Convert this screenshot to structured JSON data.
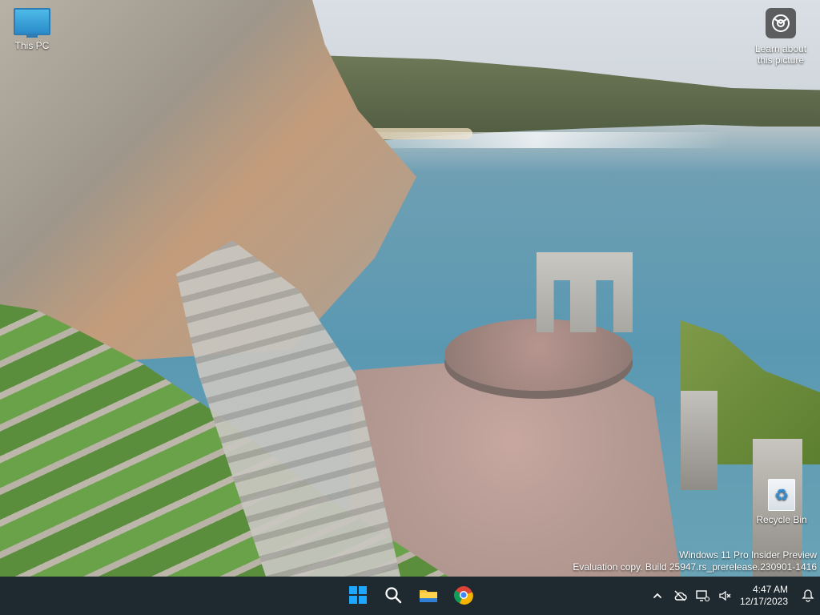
{
  "desktop": {
    "icons": [
      {
        "label": "This PC"
      },
      {
        "label": "Recycle Bin"
      }
    ],
    "spotlight": {
      "label_line1": "Learn about",
      "label_line2": "this picture"
    },
    "watermark": {
      "line1": "Windows 11 Pro Insider Preview",
      "line2": "Evaluation copy. Build 25947.rs_prerelease.230901-1416"
    }
  },
  "taskbar": {
    "apps": [
      {
        "name": "start"
      },
      {
        "name": "search"
      },
      {
        "name": "file-explorer"
      },
      {
        "name": "chrome"
      }
    ],
    "clock": {
      "time": "4:47 AM",
      "date": "12/17/2023"
    }
  }
}
